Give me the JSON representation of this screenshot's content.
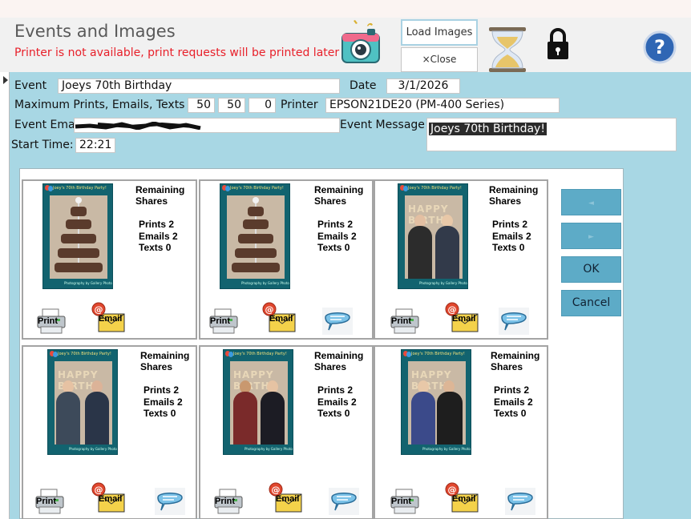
{
  "header": {
    "title": "Events and Images",
    "status_message": "Printer is not available, print requests will be printed later",
    "load_images_label": "Load Images",
    "close_label": "×Close",
    "icons": [
      "camera-icon",
      "hourglass-icon",
      "lock-icon",
      "help-icon"
    ]
  },
  "form": {
    "event_label": "Event",
    "event_value": "Joeys 70th Birthday",
    "date_label": "Date",
    "date_value": "3/1/2026",
    "max_label": "Maximum Prints, Emails, Texts",
    "max_prints": "50",
    "max_emails": "50",
    "max_texts": "0",
    "printer_label": "Printer",
    "printer_value": "EPSON21DE20 (PM-400 Series)",
    "email_label": "Event Email",
    "message_label": "Event Message",
    "message_value": "Joeys 70th Birthday!",
    "start_label": "Start Time:",
    "start_value": "22:21"
  },
  "cards": [
    {
      "title": "Joey's 70th Birthday Party!",
      "remaining": "Remaining",
      "shares": "Shares",
      "prints": "Prints 2",
      "emails": "Emails 2",
      "texts": "Texts 0",
      "print_label": "Print",
      "email_label": "Email"
    },
    {
      "title": "Joey's 70th Birthday Party!",
      "remaining": "Remaining",
      "shares": "Shares",
      "prints": "Prints 2",
      "emails": "Emails 2",
      "texts": "Texts 0",
      "print_label": "Print",
      "email_label": "Email"
    },
    {
      "title": "Joey's 70th Birthday Party!",
      "remaining": "Remaining",
      "shares": "Shares",
      "prints": "Prints 2",
      "emails": "Emails 2",
      "texts": "Texts 0",
      "print_label": "Print",
      "email_label": "Email"
    },
    {
      "title": "Joey's 70th Birthday Party!",
      "remaining": "Remaining",
      "shares": "Shares",
      "prints": "Prints 2",
      "emails": "Emails 2",
      "texts": "Texts 0",
      "print_label": "Print",
      "email_label": "Email"
    },
    {
      "title": "Joey's 70th Birthday Party!",
      "remaining": "Remaining",
      "shares": "Shares",
      "prints": "Prints 2",
      "emails": "Emails 2",
      "texts": "Texts 0",
      "print_label": "Print",
      "email_label": "Email"
    },
    {
      "title": "Joey's 70th Birthday Party!",
      "remaining": "Remaining",
      "shares": "Shares",
      "prints": "Prints 2",
      "emails": "Emails 2",
      "texts": "Texts 0",
      "print_label": "Print",
      "email_label": "Email"
    }
  ],
  "photo_banner": "HAPPY BIRTH",
  "photo_credit": "Photography by Gallery Photo",
  "side": {
    "prev_label": "◄",
    "next_label": "►",
    "ok_label": "OK",
    "cancel_label": "Cancel"
  },
  "colors": {
    "form_background": "#a8d7e4",
    "accent_button": "#5dabc7",
    "status_text": "#e8202a",
    "photo_frame": "#12636f"
  }
}
